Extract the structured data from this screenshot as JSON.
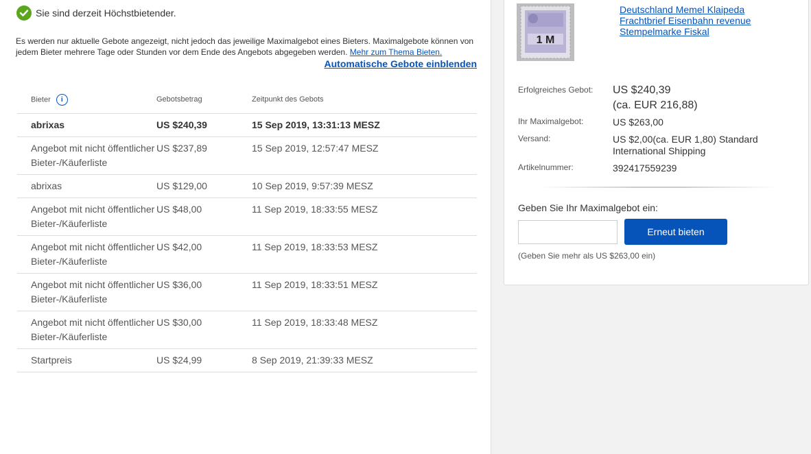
{
  "status": {
    "message": "Sie sind derzeit Höchstbietender."
  },
  "info": {
    "text": "Es werden nur aktuelle Gebote angezeigt, nicht jedoch das jeweilige Maximalgebot eines Bieters. Maximalgebote können von jedem Bieter mehrere Tage oder Stunden vor dem Ende des Angebots abgegeben werden.",
    "link": "Mehr zum Thema Bieten."
  },
  "auto_bids_link": "Automatische Gebote einblenden",
  "table": {
    "headers": [
      "Bieter",
      "Gebotsbetrag",
      "Zeitpunkt des Gebots"
    ],
    "rows": [
      {
        "bidder": "abrixas",
        "amount": "US $240,39",
        "time": "15 Sep 2019, 13:31:13 MESZ"
      },
      {
        "bidder": "Angebot mit nicht öffentlicher Bieter-/Käuferliste",
        "amount": "US $237,89",
        "time": "15 Sep 2019, 12:57:47 MESZ"
      },
      {
        "bidder": "abrixas",
        "amount": "US $129,00",
        "time": "10 Sep 2019, 9:57:39 MESZ"
      },
      {
        "bidder": "Angebot mit nicht öffentlicher Bieter-/Käuferliste",
        "amount": "US $48,00",
        "time": "11 Sep 2019, 18:33:55 MESZ"
      },
      {
        "bidder": "Angebot mit nicht öffentlicher Bieter-/Käuferliste",
        "amount": "US $42,00",
        "time": "11 Sep 2019, 18:33:53 MESZ"
      },
      {
        "bidder": "Angebot mit nicht öffentlicher Bieter-/Käuferliste",
        "amount": "US $36,00",
        "time": "11 Sep 2019, 18:33:51 MESZ"
      },
      {
        "bidder": "Angebot mit nicht öffentlicher Bieter-/Käuferliste",
        "amount": "US $30,00",
        "time": "11 Sep 2019, 18:33:48 MESZ"
      },
      {
        "bidder": "Startpreis",
        "amount": "US $24,99",
        "time": "8 Sep 2019, 21:39:33 MESZ"
      }
    ]
  },
  "item": {
    "title": "Deutschland Memel Klaipeda Frachtbrief Eisenbahn revenue Stempelmarke Fiskal",
    "thumbnail_text": "1 M",
    "details": [
      {
        "label": "Erfolgreiches Gebot:",
        "value": "US $240,39",
        "sub": "(ca. EUR 216,88)"
      },
      {
        "label": "Ihr Maximalgebot:",
        "value": "US $263,00"
      },
      {
        "label": "Versand:",
        "value": "US $2,00(ca. EUR 1,80) Standard International Shipping"
      },
      {
        "label": "Artikelnummer:",
        "value": "392417559239"
      }
    ]
  },
  "bid_form": {
    "label": "Geben Sie Ihr Maximalgebot ein:",
    "input_value": "",
    "button": "Erneut bieten",
    "hint": "(Geben Sie mehr als US $263,00 ein)"
  },
  "colors": {
    "accent": "#0654ba",
    "success": "#5ba71b"
  },
  "icons": [
    "checkmark-icon",
    "info-icon"
  ]
}
